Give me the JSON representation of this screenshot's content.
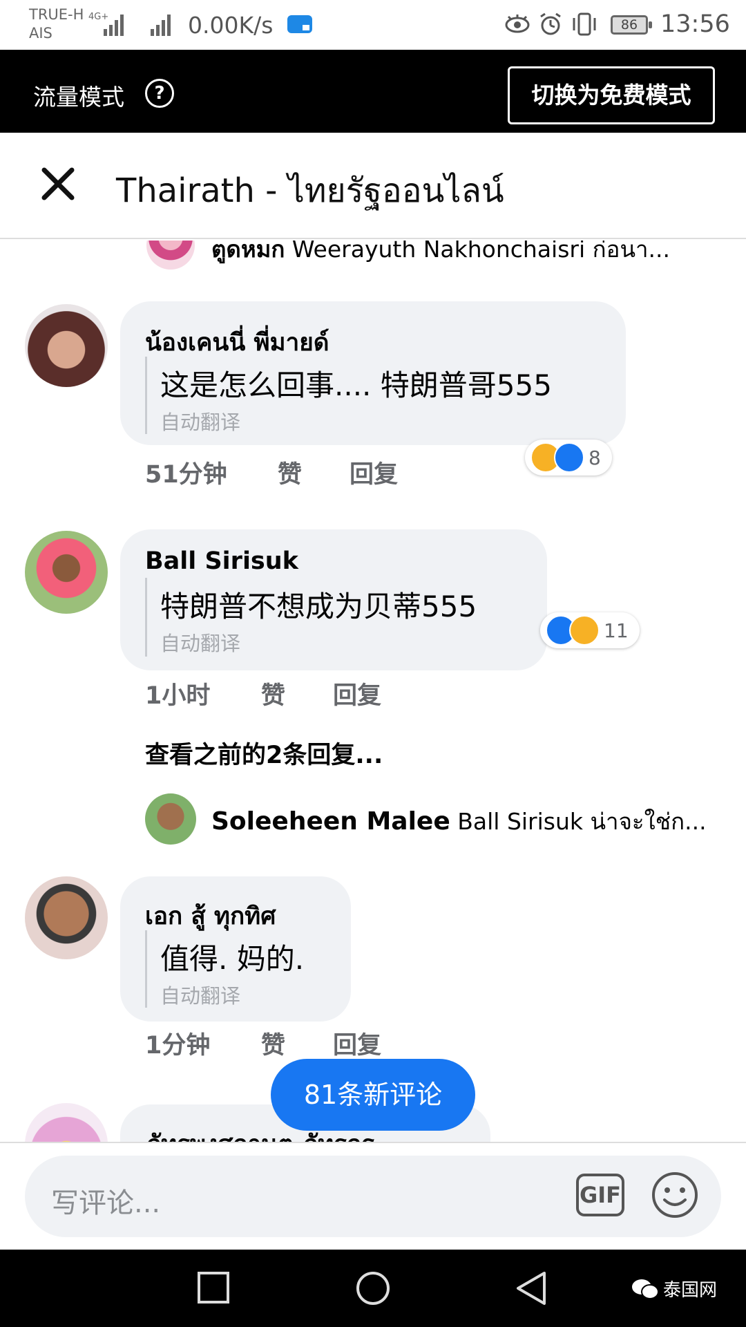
{
  "status_bar": {
    "carrier_top": "TRUE-H",
    "carrier_bottom": "AIS",
    "net_type": "4G+",
    "net_speed": "0.00K/s",
    "battery": "86",
    "time": "13:56"
  },
  "mode_bar": {
    "label": "流量模式",
    "help_icon": "?",
    "switch_button": "切换为免费模式"
  },
  "header": {
    "title": "Thairath - ไทยรัฐออนไลน์"
  },
  "comments": [
    {
      "type": "reply",
      "name": "ตูดหมก",
      "text": "Weerayuth Nakhonchaisri ก่อนา..."
    },
    {
      "type": "comment",
      "name": "น้องเคนนี่ พี่มายด์",
      "text": "这是怎么回事.... 特朗普哥555",
      "auto": "自动翻译",
      "time": "51分钟",
      "like": "赞",
      "reply": "回复",
      "reactions": {
        "icons": [
          "haha-icon",
          "like-icon"
        ],
        "count": "8"
      }
    },
    {
      "type": "comment",
      "name": "Ball Sirisuk",
      "text": "特朗普不想成为贝蒂555",
      "auto": "自动翻译",
      "time": "1小时",
      "like": "赞",
      "reply": "回复",
      "reactions": {
        "icons": [
          "like-icon",
          "haha-icon"
        ],
        "count": "11"
      }
    },
    {
      "type": "view_previous",
      "text": "查看之前的2条回复..."
    },
    {
      "type": "reply",
      "name": "Soleeheen Malee",
      "text": "Ball Sirisuk น่าจะใช่ก..."
    },
    {
      "type": "comment",
      "name": "เอก สู้ ทุกทิศ",
      "text": "值得. 妈的.",
      "auto": "自动翻译",
      "time": "1分钟",
      "like": "赞",
      "reply": "回复"
    },
    {
      "type": "comment_partial",
      "name": "ภัทรพงศกานต ภัทรกร"
    }
  ],
  "new_comments_button": "81条新评论",
  "composer": {
    "placeholder": "写评论...",
    "gif": "GIF"
  },
  "watermark": "泰国网"
}
